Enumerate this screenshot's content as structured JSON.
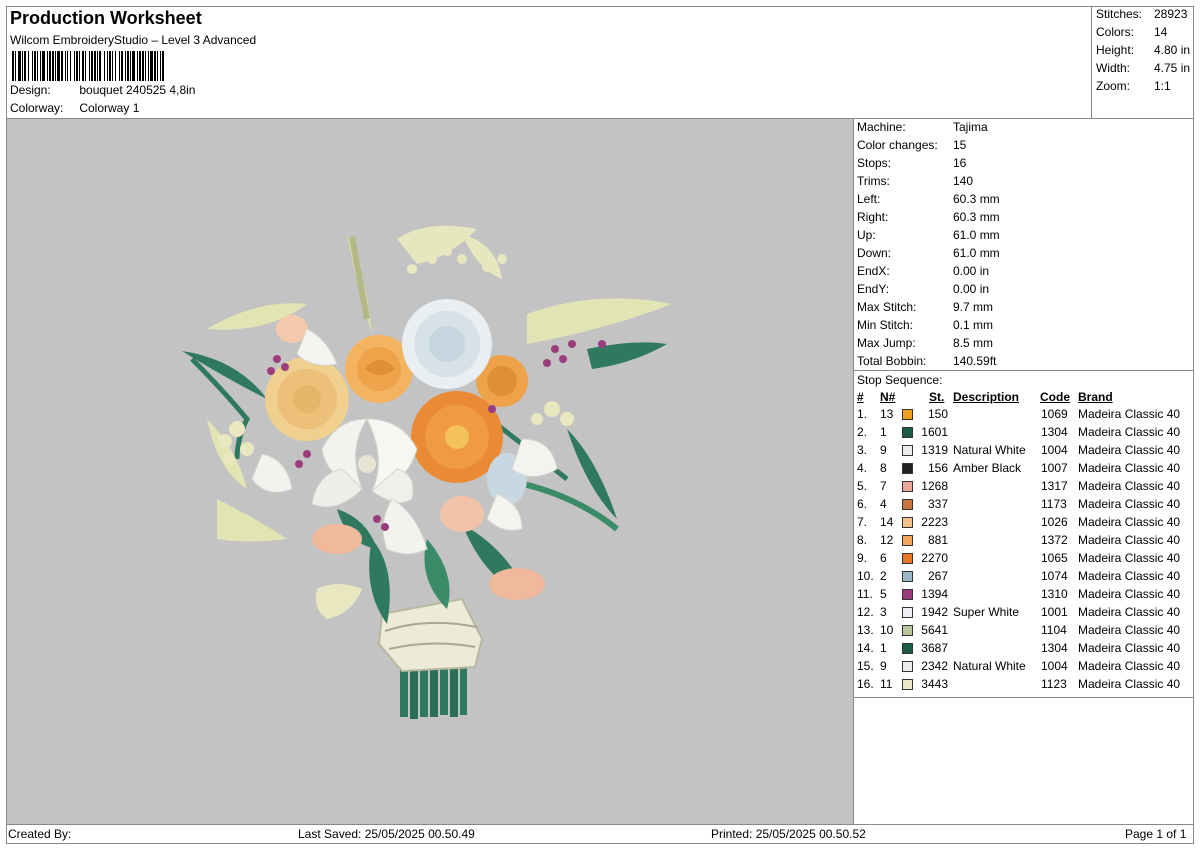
{
  "header": {
    "title": "Production Worksheet",
    "subtitle": "Wilcom EmbroideryStudio – Level 3 Advanced",
    "design_label": "Design:",
    "design_value": "bouquet 240525 4,8in",
    "colorway_label": "Colorway:",
    "colorway_value": "Colorway 1"
  },
  "summary": [
    {
      "label": "Stitches:",
      "value": "28923"
    },
    {
      "label": "Colors:",
      "value": "14"
    },
    {
      "label": "Height:",
      "value": "4.80 in"
    },
    {
      "label": "Width:",
      "value": "4.75 in"
    },
    {
      "label": "Zoom:",
      "value": "1:1"
    }
  ],
  "machine": [
    {
      "label": "Machine:",
      "value": "Tajima"
    },
    {
      "label": "Color changes:",
      "value": "15"
    },
    {
      "label": "Stops:",
      "value": "16"
    },
    {
      "label": "Trims:",
      "value": "140"
    },
    {
      "label": "Left:",
      "value": "60.3 mm"
    },
    {
      "label": "Right:",
      "value": "60.3 mm"
    },
    {
      "label": "Up:",
      "value": "61.0 mm"
    },
    {
      "label": "Down:",
      "value": "61.0 mm"
    },
    {
      "label": "EndX:",
      "value": "0.00 in"
    },
    {
      "label": "EndY:",
      "value": "0.00 in"
    },
    {
      "label": "Max Stitch:",
      "value": "9.7 mm"
    },
    {
      "label": "Min Stitch:",
      "value": "0.1 mm"
    },
    {
      "label": "Max Jump:",
      "value": "8.5 mm"
    },
    {
      "label": "Total Bobbin:",
      "value": "140.59ft"
    }
  ],
  "stop_sequence": {
    "title": "Stop Sequence:",
    "headers": {
      "num": "#",
      "n": "N#",
      "st": "St.",
      "desc": "Description",
      "code": "Code",
      "brand": "Brand"
    },
    "rows": [
      {
        "num": "1.",
        "n": "13",
        "color": "#f0a020",
        "st": "150",
        "desc": "",
        "code": "1069",
        "brand": "Madeira Classic 40"
      },
      {
        "num": "2.",
        "n": "1",
        "color": "#1d5a47",
        "st": "1601",
        "desc": "",
        "code": "1304",
        "brand": "Madeira Classic 40"
      },
      {
        "num": "3.",
        "n": "9",
        "color": "#ececec",
        "st": "1319",
        "desc": "Natural White",
        "code": "1004",
        "brand": "Madeira Classic 40"
      },
      {
        "num": "4.",
        "n": "8",
        "color": "#222222",
        "st": "156",
        "desc": "Amber Black",
        "code": "1007",
        "brand": "Madeira Classic 40"
      },
      {
        "num": "5.",
        "n": "7",
        "color": "#eaa79a",
        "st": "1268",
        "desc": "",
        "code": "1317",
        "brand": "Madeira Classic 40"
      },
      {
        "num": "6.",
        "n": "4",
        "color": "#c9753f",
        "st": "337",
        "desc": "",
        "code": "1173",
        "brand": "Madeira Classic 40"
      },
      {
        "num": "7.",
        "n": "14",
        "color": "#f4c08c",
        "st": "2223",
        "desc": "",
        "code": "1026",
        "brand": "Madeira Classic 40"
      },
      {
        "num": "8.",
        "n": "12",
        "color": "#f2a65a",
        "st": "881",
        "desc": "",
        "code": "1372",
        "brand": "Madeira Classic 40"
      },
      {
        "num": "9.",
        "n": "6",
        "color": "#e9772a",
        "st": "2270",
        "desc": "",
        "code": "1065",
        "brand": "Madeira Classic 40"
      },
      {
        "num": "10.",
        "n": "2",
        "color": "#9ab7c4",
        "st": "267",
        "desc": "",
        "code": "1074",
        "brand": "Madeira Classic 40"
      },
      {
        "num": "11.",
        "n": "5",
        "color": "#9b3d7c",
        "st": "1394",
        "desc": "",
        "code": "1310",
        "brand": "Madeira Classic 40"
      },
      {
        "num": "12.",
        "n": "3",
        "color": "#eeeef5",
        "st": "1942",
        "desc": "Super White",
        "code": "1001",
        "brand": "Madeira Classic 40"
      },
      {
        "num": "13.",
        "n": "10",
        "color": "#b9c49a",
        "st": "5641",
        "desc": "",
        "code": "1104",
        "brand": "Madeira Classic 40"
      },
      {
        "num": "14.",
        "n": "1",
        "color": "#1d5a47",
        "st": "3687",
        "desc": "",
        "code": "1304",
        "brand": "Madeira Classic 40"
      },
      {
        "num": "15.",
        "n": "9",
        "color": "#ececec",
        "st": "2342",
        "desc": "Natural White",
        "code": "1004",
        "brand": "Madeira Classic 40"
      },
      {
        "num": "16.",
        "n": "11",
        "color": "#efe8c8",
        "st": "3443",
        "desc": "",
        "code": "1123",
        "brand": "Madeira Classic 40"
      }
    ]
  },
  "footer": {
    "created_by": "Created By:",
    "last_saved": "Last Saved: 25/05/2025 00.50.49",
    "printed": "Printed: 25/05/2025 00.50.52",
    "page": "Page 1 of 1"
  },
  "colors": {
    "canvas_bg": "#c3c3c3",
    "leaf_green": "#2f7a5e",
    "cream": "#ecebc6",
    "orange": "#e9862f",
    "peach": "#f0b774",
    "white_flower": "#f2f2ef",
    "blue_flower": "#cdd9e6",
    "magenta": "#9b3d7c"
  }
}
